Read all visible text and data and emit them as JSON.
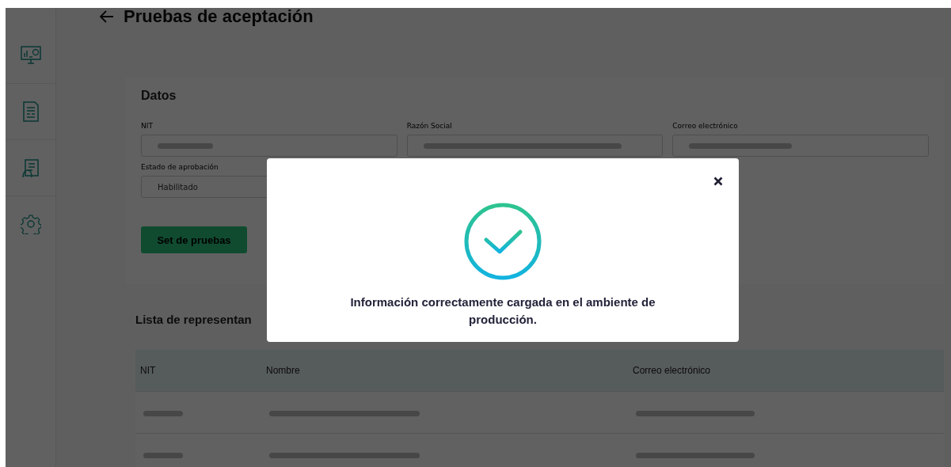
{
  "header": {
    "title": "Pruebas de aceptación"
  },
  "sidebar": {
    "items": [
      {
        "kind": "monitor"
      },
      {
        "kind": "document"
      },
      {
        "kind": "clipboard"
      },
      {
        "kind": "settings"
      }
    ]
  },
  "datos": {
    "title": "Datos",
    "fields": [
      {
        "label": "NIT",
        "redacted": true
      },
      {
        "label": "Razón Social",
        "redacted": true
      },
      {
        "label": "Correo electrónico",
        "redacted": true
      },
      {
        "label": "Estado de aprobación",
        "value": "Habilitado"
      }
    ],
    "button": "Set de pruebas"
  },
  "list": {
    "title": "Lista de representan",
    "columns": [
      "NIT",
      "Nombre",
      "Correo electrónico"
    ],
    "rows": [
      {
        "redacted": true
      },
      {
        "redacted": true
      }
    ]
  },
  "modal": {
    "message": "Información correctamente cargada en el ambiente de producción."
  }
}
